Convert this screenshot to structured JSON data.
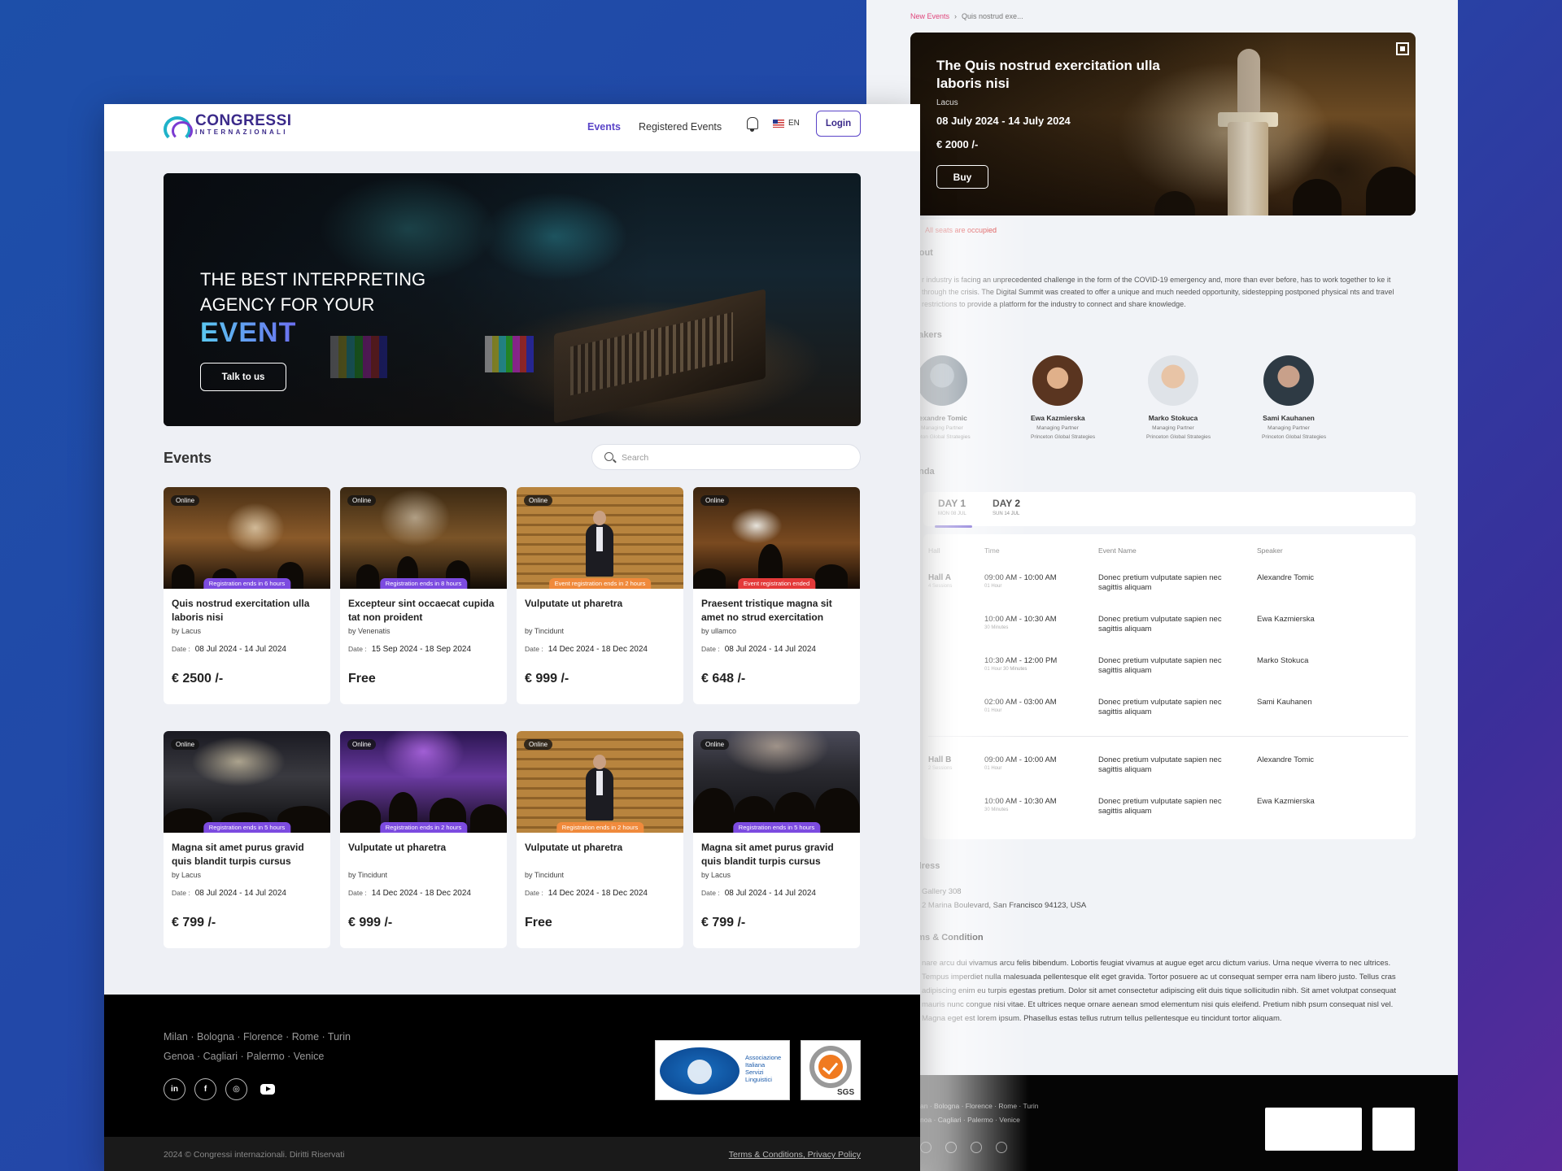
{
  "detail": {
    "breadcrumb": [
      "New Events",
      "Quis nostrud exe..."
    ],
    "hero": {
      "title": "The Quis nostrud exercitation ulla laboris nisi",
      "by": "Lacus",
      "dates": "08 July 2024 - 14 July 2024",
      "price": "€ 2000 /-",
      "buy_label": "Buy"
    },
    "seats_status": "All seats are occupied",
    "about_title": "bout",
    "about_text": "r industry is facing an unprecedented challenge in the form of the COVID-19 emergency and, more than ever before, has to work together to ke it through the crisis. The Digital Summit was created to offer a unique and much needed opportunity, sidestepping postponed physical nts and travel restrictions to provide a platform for the industry to connect and share knowledge.",
    "speakers_title": "eakers",
    "speakers": [
      {
        "name": "lexandre Tomic",
        "role": "Managing Partner",
        "company": "ceton Global Strategies",
        "color": "#5a6a78"
      },
      {
        "name": "Ewa Kazmierska",
        "role": "Managing Partner",
        "company": "Princeton Global Strategies",
        "color": "#8a5a3a"
      },
      {
        "name": "Marko Stokuca",
        "role": "Managing Partner",
        "company": "Princeton Global Strategies",
        "color": "#c8a080"
      },
      {
        "name": "Sami Kauhanen",
        "role": "Managing Partner",
        "company": "Princeton Global Strategies",
        "color": "#3a4650"
      }
    ],
    "agenda_title": "enda",
    "days": [
      {
        "label": "DAY 1",
        "sub": "MON 08 JUL"
      },
      {
        "label": "DAY 2",
        "sub": "SUN 14 JUL"
      }
    ],
    "agenda_headers": [
      "Hall",
      "Time",
      "Event Name",
      "Speaker"
    ],
    "halls": [
      {
        "name": "Hall A",
        "sessions": "4 Sessions"
      },
      {
        "name": "Hall B",
        "sessions": "2 Sessions"
      }
    ],
    "agenda_rows": [
      {
        "time": "09:00 AM - 10:00 AM",
        "dur": "01 Hour",
        "event": "Donec pretium vulputate sapien nec sagittis aliquam",
        "speaker": "Alexandre Tomic"
      },
      {
        "time": "10:00 AM - 10:30 AM",
        "dur": "30 Minutes",
        "event": "Donec pretium vulputate sapien nec sagittis aliquam",
        "speaker": "Ewa Kazmierska"
      },
      {
        "time": "10:30 AM - 12:00 PM",
        "dur": "01 Hour 30 Minutes",
        "event": "Donec pretium vulputate sapien nec sagittis aliquam",
        "speaker": "Marko Stokuca"
      },
      {
        "time": "02:00 AM - 03:00 AM",
        "dur": "01 Hour",
        "event": "Donec pretium vulputate sapien nec sagittis aliquam",
        "speaker": "Sami Kauhanen"
      },
      {
        "time": "09:00 AM - 10:00 AM",
        "dur": "01 Hour",
        "event": "Donec pretium vulputate sapien nec sagittis aliquam",
        "speaker": "Alexandre Tomic"
      },
      {
        "time": "10:00 AM - 10:30 AM",
        "dur": "30 Minutes",
        "event": "Donec pretium vulputate sapien nec sagittis aliquam",
        "speaker": "Ewa Kazmierska"
      }
    ],
    "address_title": "ldress",
    "address_line1": "Gallery 308",
    "address_line2": "2 Marina Boulevard, San Francisco 94123, USA",
    "terms_title": "rms & Condition",
    "terms_text": "nare arcu dui vivamus arcu felis bibendum. Lobortis feugiat vivamus at augue eget arcu dictum varius. Urna neque viverra to nec ultrices. Tempus imperdiet nulla malesuada pellentesque elit eget gravida. Tortor posuere ac ut consequat semper erra nam libero justo. Tellus cras adipiscing enim eu turpis egestas pretium. Dolor sit amet consectetur adipiscing elit duis tique sollicitudin nibh. Sit amet volutpat consequat mauris nunc congue nisi vitae. Et ultrices neque ornare aenean smod elementum nisi quis eleifend. Pretium nibh psum consequat nisl vel. Magna eget est lorem ipsum. Phasellus estas tellus rutrum tellus pellentesque eu tincidunt tortor aliquam.",
    "footer_cities_1": "an · Bologna · Florence · Rome · Turin",
    "footer_cities_2": "noa · Cagliari · Palermo · Venice"
  },
  "nav": {
    "logo_line1": "CONGRESSI",
    "logo_line2": "INTERNAZIONALI",
    "events": "Events",
    "registered": "Registered Events",
    "lang": "EN",
    "login": "Login"
  },
  "hero": {
    "line1": "THE BEST INTERPRETING",
    "line2": "AGENCY FOR YOUR",
    "highlight": "EVENT",
    "cta": "Talk to us"
  },
  "events_section": {
    "title": "Events",
    "search_placeholder": "Search"
  },
  "events": [
    {
      "badge": "Online",
      "reg": "Registration ends in 6 hours",
      "reg_color": "purple",
      "title": "Quis nostrud exercitation ulla laboris nisi",
      "by": "by Lacus",
      "date_label": "Date :",
      "date": "08 Jul 2024 - 14 Jul 2024",
      "price": "€ 2500 /-",
      "img": "img-a"
    },
    {
      "badge": "Online",
      "reg": "Registration ends in 8 hours",
      "reg_color": "purple",
      "title": "Excepteur sint occaecat cupida tat non proident",
      "by": "by Venenatis",
      "date_label": "Date :",
      "date": "15 Sep 2024 - 18 Sep 2024",
      "price": "Free",
      "img": "img-b"
    },
    {
      "badge": "Online",
      "reg": "Event registration ends in 2 hours",
      "reg_color": "orange",
      "title": "Vulputate ut pharetra",
      "by": "by Tincidunt",
      "date_label": "Date :",
      "date": "14 Dec 2024 - 18 Dec 2024",
      "price": "€ 999 /-",
      "img": "img-c"
    },
    {
      "badge": "Online",
      "reg": "Event registration ended",
      "reg_color": "red",
      "title": "Praesent tristique magna sit amet no strud exercitation",
      "by": "by ullamco",
      "date_label": "Date :",
      "date": "08 Jul 2024 - 14 Jul 2024",
      "price": "€ 648 /-",
      "img": "img-d"
    },
    {
      "badge": "Online",
      "reg": "Registration ends in 5 hours",
      "reg_color": "purple",
      "title": "Magna sit amet purus gravid quis blandit turpis cursus",
      "by": "by Lacus",
      "date_label": "Date :",
      "date": "08 Jul 2024 - 14 Jul 2024",
      "price": "€ 799 /-",
      "img": "img-e"
    },
    {
      "badge": "Online",
      "reg": "Registration ends in 2 hours",
      "reg_color": "purple",
      "title": "Vulputate ut pharetra",
      "by": "by Tincidunt",
      "date_label": "Date :",
      "date": "14 Dec 2024 - 18 Dec 2024",
      "price": "€ 999 /-",
      "img": "img-f"
    },
    {
      "badge": "Online",
      "reg": "Registration ends in 2 hours",
      "reg_color": "orange",
      "title": "Vulputate ut pharetra",
      "by": "by Tincidunt",
      "date_label": "Date :",
      "date": "14 Dec 2024 - 18 Dec 2024",
      "price": "Free",
      "img": "img-g"
    },
    {
      "badge": "Online",
      "reg": "Registration ends in 5 hours",
      "reg_color": "purple",
      "title": "Magna sit amet purus gravid quis blandit turpis cursus",
      "by": "by Lacus",
      "date_label": "Date :",
      "date": "08 Jul 2024 - 14 Jul 2024",
      "price": "€ 799 /-",
      "img": "img-h"
    }
  ],
  "footer": {
    "cities_1": "Milan · Bologna · Florence · Rome · Turin",
    "cities_2": "Genoa · Cagliari · Palermo · Venice",
    "socials": [
      "in",
      "f",
      "ig",
      "yt"
    ],
    "fed_text": [
      "Associazione",
      "Italiana",
      "Servizi",
      "Linguistici"
    ],
    "sgs": "SGS",
    "copyright": "2024 © Congressi internazionali. Diritti Riservati",
    "links": "Terms & Conditions, Privacy Policy"
  }
}
